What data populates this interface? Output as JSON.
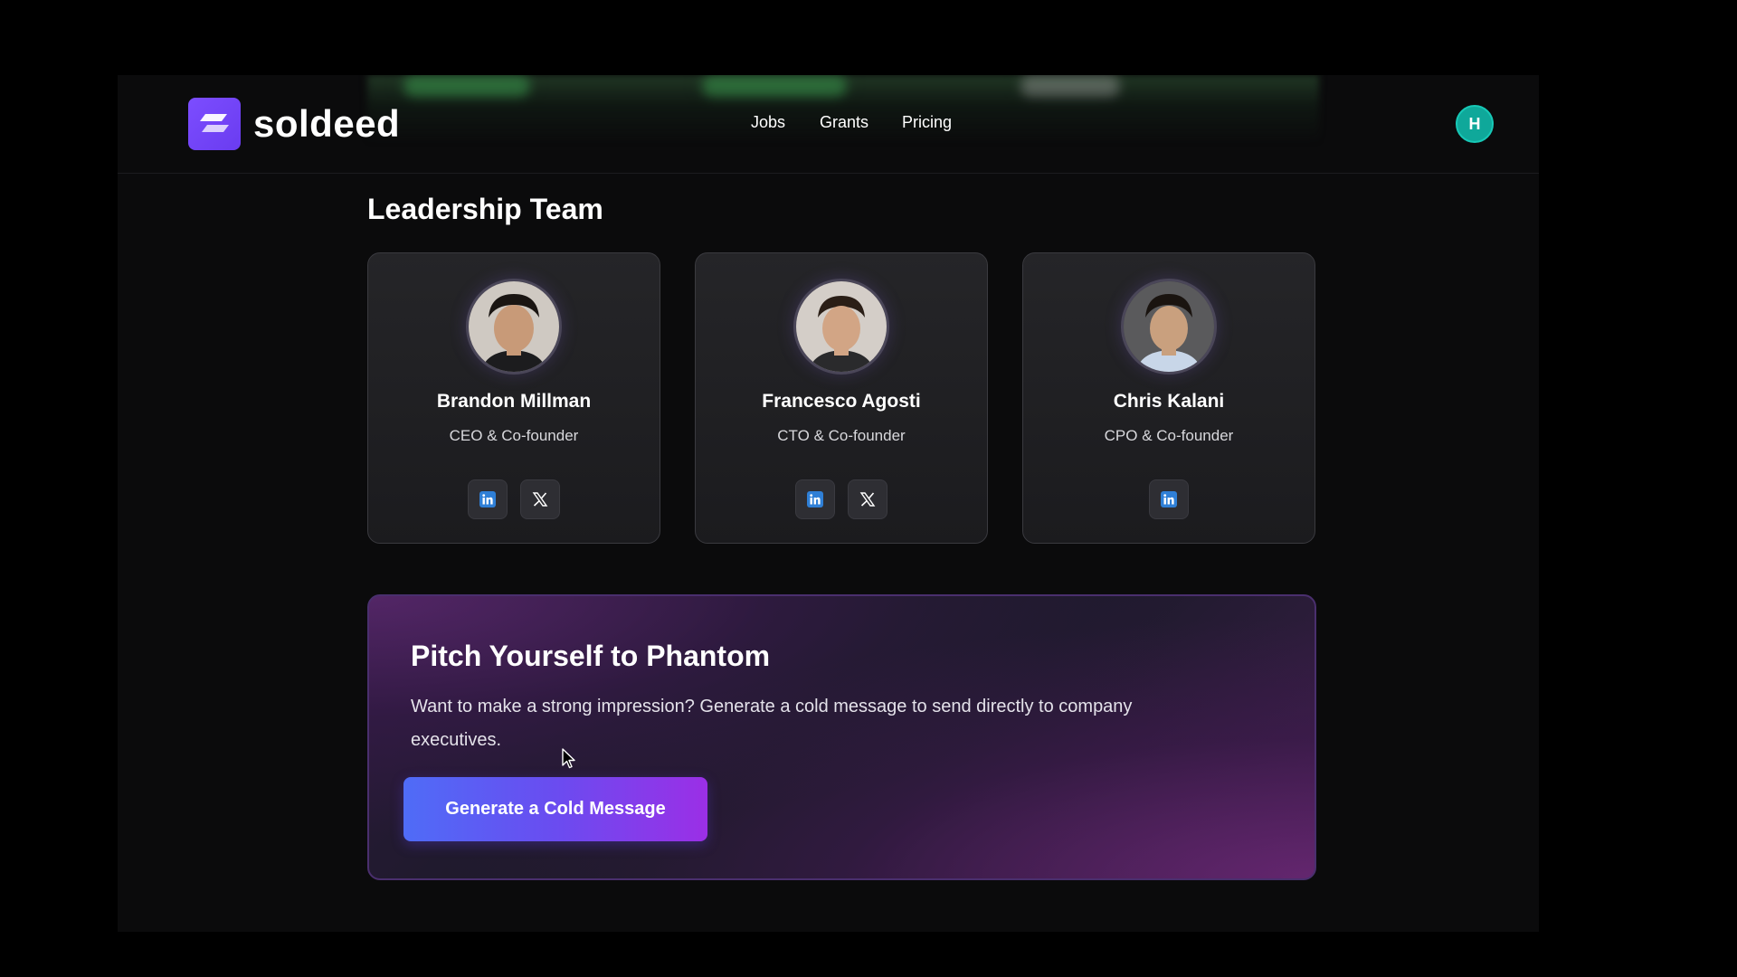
{
  "brand": {
    "name": "soldeed",
    "logo_icon": "soldeed-logo-icon",
    "accent": "#7c4dff"
  },
  "nav": {
    "items": [
      {
        "label": "Jobs"
      },
      {
        "label": "Grants"
      },
      {
        "label": "Pricing"
      }
    ]
  },
  "user": {
    "initial": "H",
    "avatar_color": "#0fa89a"
  },
  "leadership": {
    "title": "Leadership Team",
    "members": [
      {
        "name": "Brandon Millman",
        "role": "CEO & Co-founder",
        "socials": [
          "linkedin-icon",
          "x-icon"
        ]
      },
      {
        "name": "Francesco Agosti",
        "role": "CTO & Co-founder",
        "socials": [
          "linkedin-icon",
          "x-icon"
        ]
      },
      {
        "name": "Chris Kalani",
        "role": "CPO & Co-founder",
        "socials": [
          "linkedin-icon"
        ]
      }
    ]
  },
  "pitch": {
    "title": "Pitch Yourself to Phantom",
    "description": "Want to make a strong impression? Generate a cold message to send directly to company executives.",
    "button_label": "Generate a Cold Message",
    "gradient_start": "#4f6cf7",
    "gradient_end": "#9b2fe6"
  }
}
